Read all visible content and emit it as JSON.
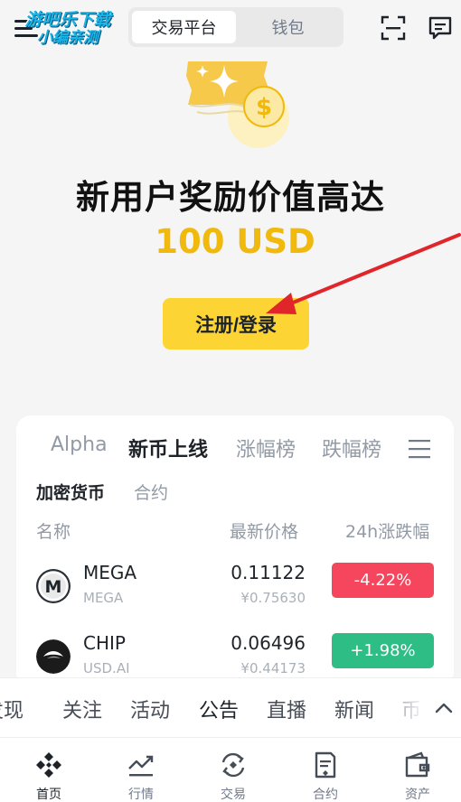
{
  "watermark": {
    "line1": "游吧乐下载",
    "line2": "小编亲测"
  },
  "header": {
    "tabs": [
      {
        "label": "交易平台",
        "active": true
      },
      {
        "label": "钱包",
        "active": false
      }
    ],
    "icons": [
      "menu-icon",
      "scan-icon",
      "message-icon"
    ]
  },
  "hero": {
    "title": "新用户奖励价值高达",
    "amount": "100 USD",
    "cta_label": "注册/登录",
    "accent_color": "#F0B90B",
    "cta_color": "#FCD535"
  },
  "market": {
    "tabs": [
      {
        "label": "Alpha",
        "active": false
      },
      {
        "label": "新币上线",
        "active": true
      },
      {
        "label": "涨幅榜",
        "active": false
      },
      {
        "label": "跌幅榜",
        "active": false
      }
    ],
    "subtabs": [
      {
        "label": "加密货币",
        "active": true
      },
      {
        "label": "合约",
        "active": false
      }
    ],
    "columns": {
      "name": "名称",
      "price": "最新价格",
      "change": "24h涨跌幅"
    },
    "rows": [
      {
        "name": "MEGA",
        "sub": "MEGA",
        "price": "0.11122",
        "fiat": "¥0.75630",
        "change": "-4.22%",
        "direction": "down"
      },
      {
        "name": "CHIP",
        "sub": "USD.AI",
        "price": "0.06496",
        "fiat": "¥0.44173",
        "change": "+1.98%",
        "direction": "up"
      }
    ],
    "colors": {
      "up": "#2EBD85",
      "down": "#F6465D"
    }
  },
  "categories": [
    {
      "label": "发现",
      "active": false
    },
    {
      "label": "关注",
      "active": false
    },
    {
      "label": "活动",
      "active": false
    },
    {
      "label": "公告",
      "active": true
    },
    {
      "label": "直播",
      "active": false
    },
    {
      "label": "新闻",
      "active": false
    },
    {
      "label": "币",
      "active": false
    }
  ],
  "bottom_nav": [
    {
      "label": "首页",
      "icon": "home-icon",
      "active": true
    },
    {
      "label": "行情",
      "icon": "markets-icon",
      "active": false
    },
    {
      "label": "交易",
      "icon": "trade-icon",
      "active": false
    },
    {
      "label": "合约",
      "icon": "futures-icon",
      "active": false
    },
    {
      "label": "资产",
      "icon": "wallet-icon",
      "active": false
    }
  ]
}
